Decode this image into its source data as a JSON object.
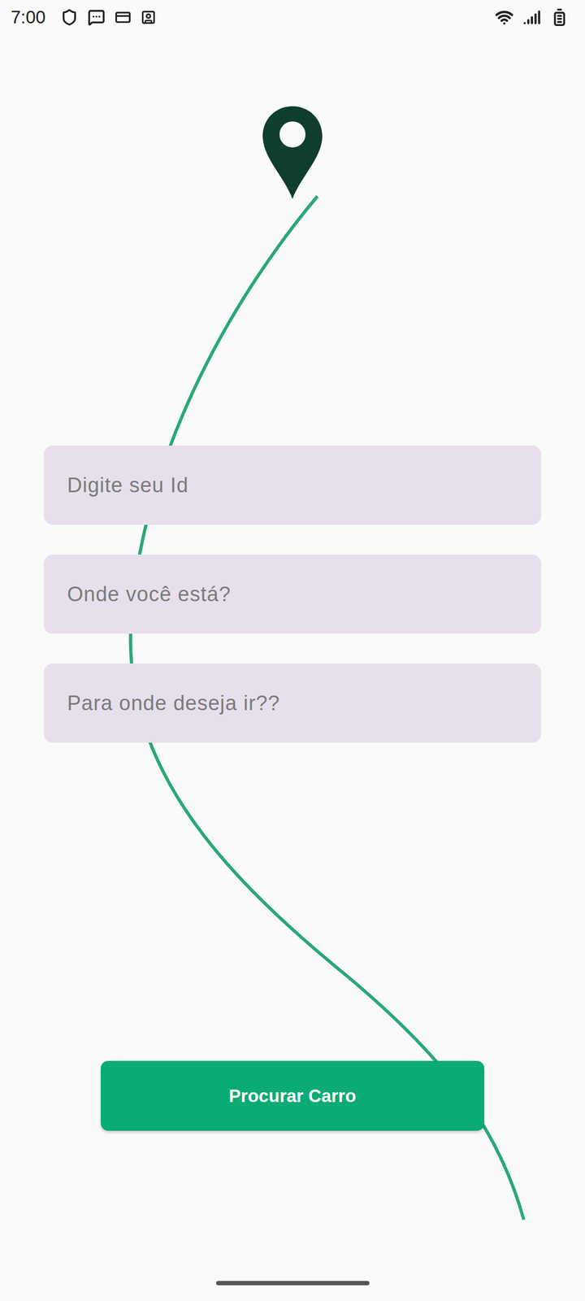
{
  "status_bar": {
    "time": "7:00"
  },
  "fields": [
    {
      "placeholder": "Digite seu Id"
    },
    {
      "placeholder": "Onde você está?"
    },
    {
      "placeholder": "Para onde deseja ir??"
    }
  ],
  "button": {
    "label": "Procurar Carro"
  }
}
